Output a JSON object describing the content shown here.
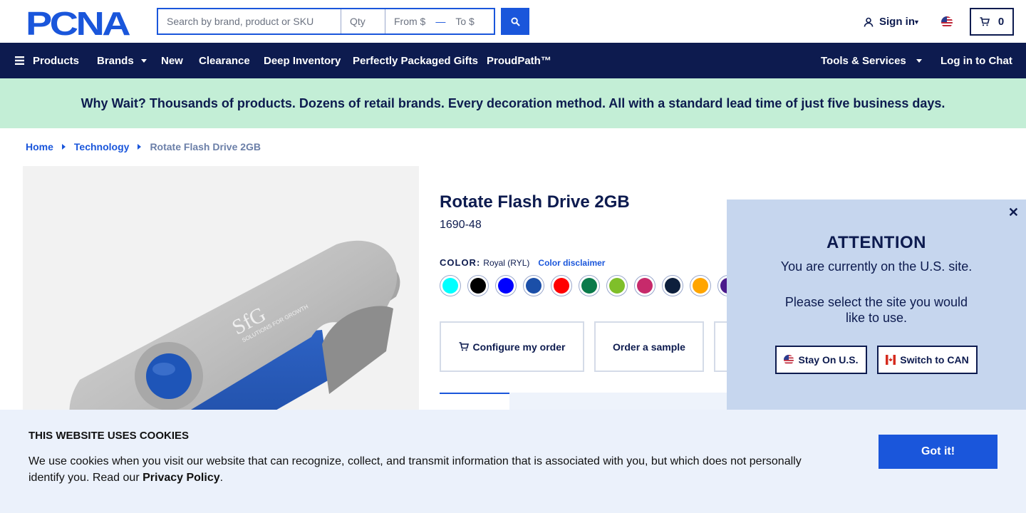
{
  "header": {
    "logo_text": "PCNA",
    "search_placeholder": "Search by brand, product or SKU",
    "qty_placeholder": "Qty",
    "from_placeholder": "From $",
    "range_dash": "—",
    "to_placeholder": "To $",
    "signin_label": "Sign in",
    "cart_count": "0"
  },
  "nav": {
    "products": "Products",
    "brands": "Brands",
    "new": "New",
    "clearance": "Clearance",
    "deep_inventory": "Deep Inventory",
    "packaged_gifts": "Perfectly Packaged Gifts",
    "proudpath": "ProudPath™",
    "tools": "Tools & Services",
    "chat": "Log in to Chat"
  },
  "promo": "Why Wait? Thousands of products. Dozens of retail brands. Every decoration method. All with a standard lead time of just five business days.",
  "breadcrumb": {
    "home": "Home",
    "category": "Technology",
    "current": "Rotate Flash Drive 2GB"
  },
  "product": {
    "title": "Rotate Flash Drive 2GB",
    "sku": "1690-48",
    "color_label": "COLOR:",
    "color_value": "Royal (RYL)",
    "color_disclaimer": "Color disclaimer",
    "swatches": [
      "#00ffff",
      "#000000",
      "#0000ff",
      "#1b4fa8",
      "#ff0000",
      "#0a7a4a",
      "#7fbf2a",
      "#c72a6b",
      "#0d1f3c",
      "#ffa500",
      "#4b1a8c"
    ],
    "configure_label": "Configure my order",
    "sample_label": "Order a sample",
    "image_brand": "SfG",
    "image_subtext": "SOLUTIONS FOR GROWTH"
  },
  "modal": {
    "title": "ATTENTION",
    "line1": "You are currently on the U.S. site.",
    "line2": "Please select the site you would like to use.",
    "stay_label": "Stay On U.S.",
    "switch_label": "Switch to CAN"
  },
  "cookie": {
    "title": "THIS WEBSITE USES COOKIES",
    "text": "We use cookies when you visit our website that can recognize, collect, and transmit information that is associated with you, but which does not personally identify you. Read our ",
    "link": "Privacy Policy",
    "period": ".",
    "button": "Got it!"
  },
  "colors": {
    "navy": "#0d1b4f",
    "blue": "#1a56db",
    "promo_bg": "#c3eed6",
    "modal_bg": "#c6d6ee",
    "cookie_bg": "#ebf1fb"
  }
}
